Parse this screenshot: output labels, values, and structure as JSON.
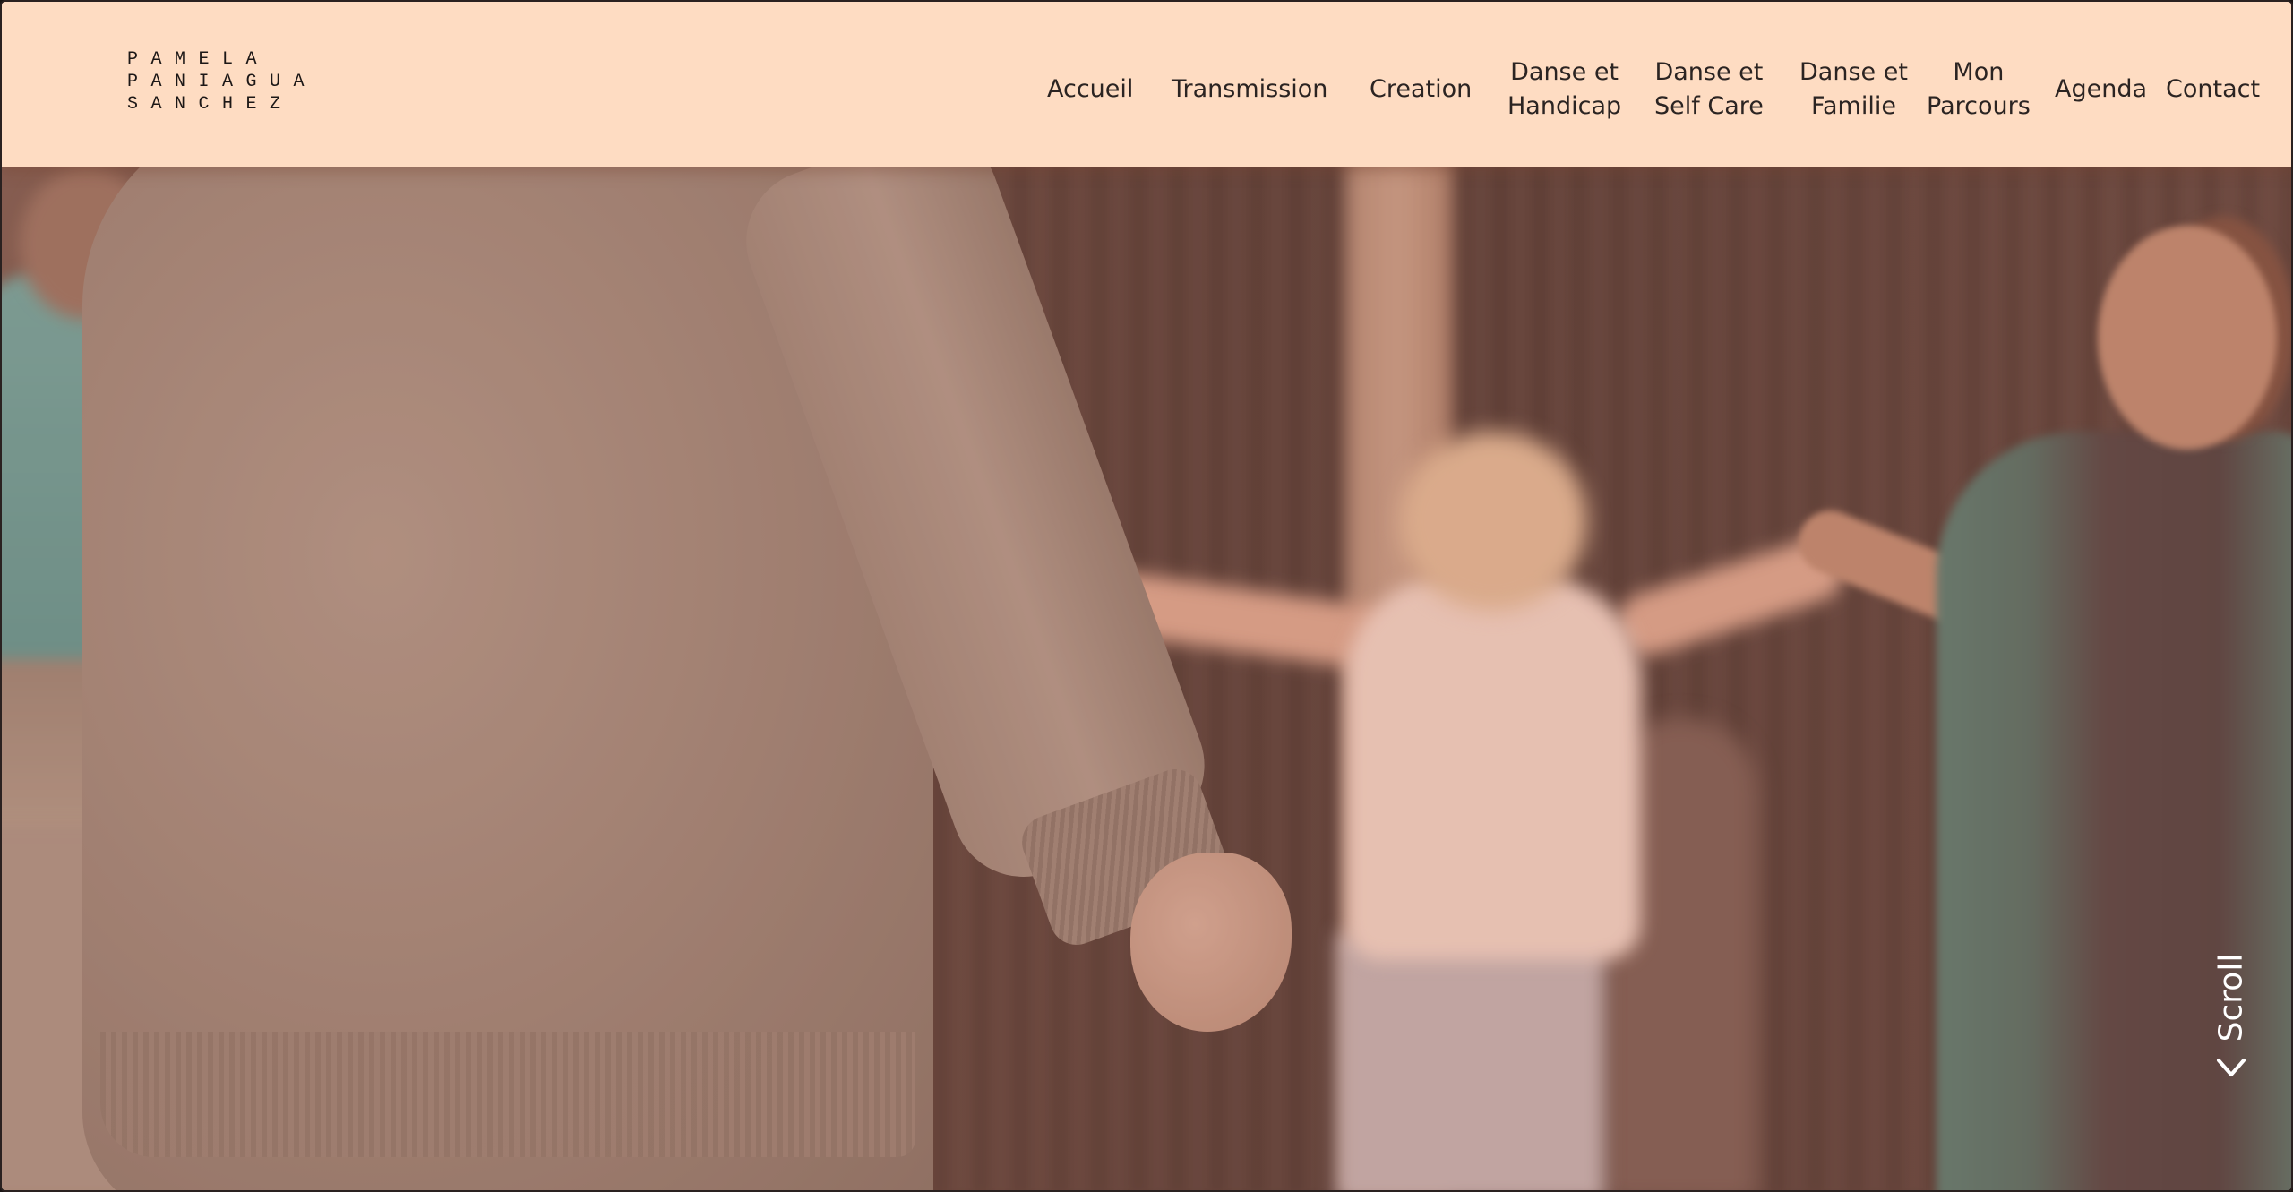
{
  "brand": {
    "logo_lines": [
      "PAMELA",
      "PANIAGUA",
      "SANCHEZ"
    ]
  },
  "nav": {
    "items": [
      {
        "id": "accueil",
        "lines": [
          "Accueil"
        ]
      },
      {
        "id": "transmission",
        "lines": [
          "Transmission"
        ]
      },
      {
        "id": "creation",
        "lines": [
          "Creation"
        ]
      },
      {
        "id": "danse-handicap",
        "lines": [
          "Danse et",
          "Handicap"
        ]
      },
      {
        "id": "danse-self-care",
        "lines": [
          "Danse et",
          "Self Care"
        ]
      },
      {
        "id": "danse-familie",
        "lines": [
          "Danse et",
          "Familie"
        ]
      },
      {
        "id": "mon-parcours",
        "lines": [
          "Mon",
          "Parcours"
        ]
      },
      {
        "id": "agenda",
        "lines": [
          "Agenda"
        ]
      },
      {
        "id": "contact",
        "lines": [
          "Contact"
        ]
      }
    ]
  },
  "hero": {
    "image_icon": "dance-workshop-photo"
  },
  "scroll_indicator": {
    "label": "Scroll",
    "icon": "chevron-down-icon"
  },
  "colors": {
    "header_bg": "#fedcc2",
    "nav_text": "#2b2422",
    "scroll_text": "#ffffff"
  }
}
